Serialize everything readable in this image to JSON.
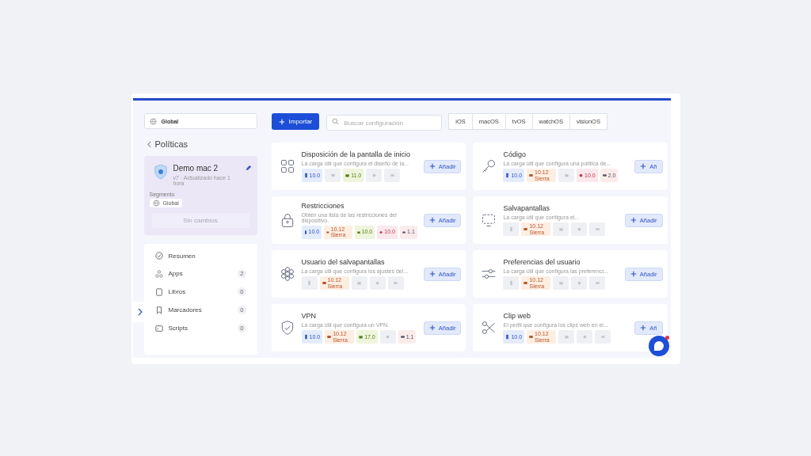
{
  "scope_select": {
    "value": "Global"
  },
  "back_link": {
    "label": "Políticas"
  },
  "policy_card": {
    "title": "Demo mac 2",
    "subtitle": "v7 · Actualizado hace 1 hora",
    "segment_label": "Segmento",
    "segment": "Global",
    "status_button": {
      "label": "Sin cambios",
      "disabled": true
    }
  },
  "nav": [
    {
      "kind": "summary",
      "label": "Resumen"
    },
    {
      "kind": "apps",
      "label": "Apps",
      "count": "2"
    },
    {
      "kind": "books",
      "label": "Libros",
      "count": "0"
    },
    {
      "kind": "bookmarks",
      "label": "Marcadores",
      "count": "0"
    },
    {
      "kind": "scripts",
      "label": "Scripts",
      "count": "0"
    }
  ],
  "toolbar": {
    "import_button": "Importar",
    "search": {
      "placeholder": "Buscar configuración"
    },
    "platform_tabs": [
      {
        "label": "iOS",
        "selected": false
      },
      {
        "label": "macOS",
        "selected": false
      },
      {
        "label": "tvOS",
        "selected": false
      },
      {
        "label": "watchOS",
        "selected": false
      },
      {
        "label": "visionOS",
        "selected": false
      }
    ]
  },
  "cards": [
    {
      "title": "Disposición de la pantalla de inicio",
      "description": "La carga útil que configura el diseño de la...",
      "add_button": "Añadir",
      "platforms": [
        {
          "kind": "ios",
          "supported": true,
          "version": "10.0"
        },
        {
          "kind": "macos",
          "supported": false
        },
        {
          "kind": "tvos",
          "supported": true,
          "version": "11.0"
        },
        {
          "kind": "watchos",
          "supported": false
        },
        {
          "kind": "visionos",
          "supported": false
        }
      ]
    },
    {
      "title": "Código",
      "description": "La carga útil que configura una política de...",
      "add_button": "Añ",
      "platforms": [
        {
          "kind": "ios",
          "supported": true,
          "version": "10.0"
        },
        {
          "kind": "macos",
          "supported": true,
          "version": "10.12 Sierra"
        },
        {
          "kind": "tvos",
          "supported": false
        },
        {
          "kind": "watchos",
          "supported": true,
          "version": "10.0"
        },
        {
          "kind": "visionos",
          "supported": true,
          "version": "2.0"
        }
      ]
    },
    {
      "title": "Restricciones",
      "description": "Obtén una lista de las restricciones del dispositivo.",
      "add_button": "Añadir",
      "platforms": [
        {
          "kind": "ios",
          "supported": true,
          "version": "10.0"
        },
        {
          "kind": "macos",
          "supported": true,
          "version": "10.12 Sierra"
        },
        {
          "kind": "tvos",
          "supported": true,
          "version": "10.0"
        },
        {
          "kind": "watchos",
          "supported": true,
          "version": "10.0"
        },
        {
          "kind": "visionos",
          "supported": true,
          "version": "1.1"
        }
      ]
    },
    {
      "title": "Salvapantallas",
      "description": "La carga útil que configura el...",
      "add_button": "Añadir",
      "platforms": [
        {
          "kind": "ios",
          "supported": false
        },
        {
          "kind": "macos",
          "supported": true,
          "version": "10.12 Sierra"
        },
        {
          "kind": "tvos",
          "supported": false
        },
        {
          "kind": "watchos",
          "supported": false
        },
        {
          "kind": "visionos",
          "supported": false
        }
      ]
    },
    {
      "title": "Usuario del salvapantallas",
      "description": "La carga útil que configura los ajustes del...",
      "add_button": "Añadir",
      "platforms": [
        {
          "kind": "ios",
          "supported": false
        },
        {
          "kind": "macos",
          "supported": true,
          "version": "10.12 Sierra"
        },
        {
          "kind": "tvos",
          "supported": false
        },
        {
          "kind": "watchos",
          "supported": false
        },
        {
          "kind": "visionos",
          "supported": false
        }
      ]
    },
    {
      "title": "Preferencias del usuario",
      "description": "La carga útil que configura las preferenci...",
      "add_button": "Añadir",
      "platforms": [
        {
          "kind": "ios",
          "supported": false
        },
        {
          "kind": "macos",
          "supported": true,
          "version": "10.12 Sierra"
        },
        {
          "kind": "tvos",
          "supported": false
        },
        {
          "kind": "watchos",
          "supported": false
        },
        {
          "kind": "visionos",
          "supported": false
        }
      ]
    },
    {
      "title": "VPN",
      "description": "La carga útil que configura un VPN.",
      "add_button": "Añadir",
      "platforms": [
        {
          "kind": "ios",
          "supported": true,
          "version": "10.0"
        },
        {
          "kind": "macos",
          "supported": true,
          "version": "10.12 Sierra"
        },
        {
          "kind": "tvos",
          "supported": true,
          "version": "17.0"
        },
        {
          "kind": "watchos",
          "supported": false
        },
        {
          "kind": "visionos",
          "supported": true,
          "version": "1.1"
        }
      ]
    },
    {
      "title": "Clip web",
      "description": "El perfil que configura los clips web en el...",
      "add_button": "Añ",
      "platforms": [
        {
          "kind": "ios",
          "supported": true,
          "version": "10.0"
        },
        {
          "kind": "macos",
          "supported": true,
          "version": "10.12 Sierra"
        },
        {
          "kind": "tvos",
          "supported": false
        },
        {
          "kind": "watchos",
          "supported": false
        },
        {
          "kind": "visionos",
          "supported": false
        }
      ]
    }
  ],
  "chat_button": {
    "unread": true
  }
}
